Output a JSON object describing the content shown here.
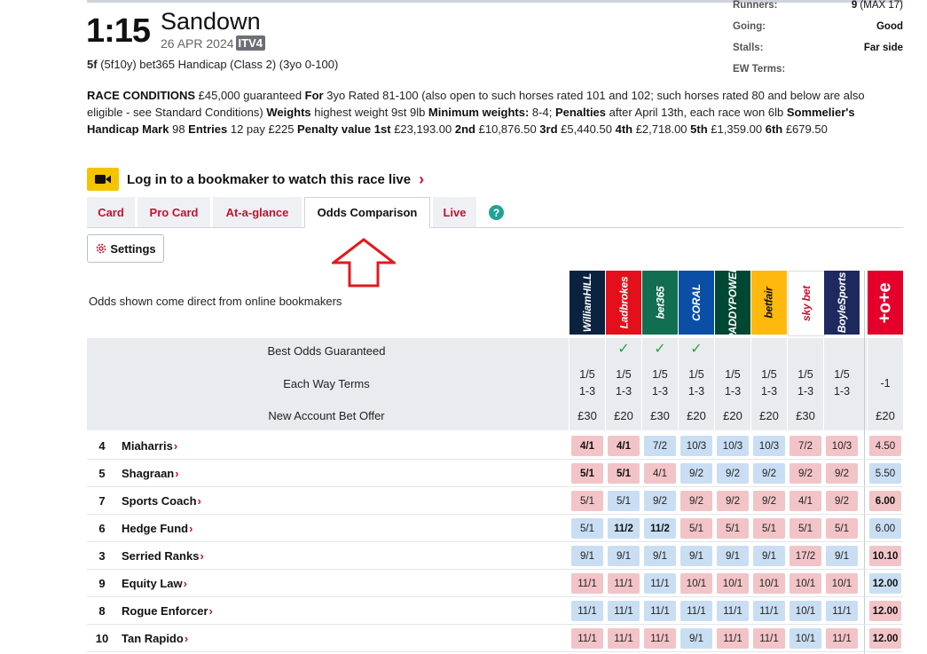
{
  "race": {
    "time": "1:15",
    "course": "Sandown",
    "date": "26 APR 2024",
    "channel": "ITV4",
    "distance": "5f",
    "description": "(5f10y) bet365 Handicap (Class 2) (3yo 0-100)"
  },
  "meta": [
    {
      "label": "Runners:",
      "value": "9",
      "extra": "(MAX 17)"
    },
    {
      "label": "Going:",
      "value": "Good",
      "extra": ""
    },
    {
      "label": "Stalls:",
      "value": "Far side",
      "extra": ""
    },
    {
      "label": "EW Terms:",
      "value": "",
      "extra": ""
    }
  ],
  "conditions": [
    {
      "b": "RACE CONDITIONS",
      "t": " £45,000 guaranteed "
    },
    {
      "b": "For",
      "t": " 3yo Rated 81-100 (also open to such horses rated 101 and 102; such horses rated 80 and below are also eligible - see Standard Conditions) "
    },
    {
      "b": "Weights",
      "t": " highest weight 9st 9lb "
    },
    {
      "b": "Minimum weights:",
      "t": " 8-4; "
    },
    {
      "b": "Penalties",
      "t": " after April 13th, each race won 6lb "
    },
    {
      "b": "Sommelier's Handicap Mark",
      "t": " 98 "
    },
    {
      "b": "Entries",
      "t": " 12 pay £225 "
    },
    {
      "b": "Penalty value",
      "t": " "
    },
    {
      "b": "1st",
      "t": " £23,193.00 "
    },
    {
      "b": "2nd",
      "t": " £10,876.50 "
    },
    {
      "b": "3rd",
      "t": " £5,440.50 "
    },
    {
      "b": "4th",
      "t": " £2,718.00 "
    },
    {
      "b": "5th",
      "t": " £1,359.00 "
    },
    {
      "b": "6th",
      "t": " £679.50"
    }
  ],
  "live_banner": {
    "text": "Log in to a bookmaker to watch this race live",
    "icon": "video-camera-icon"
  },
  "tabs": [
    "Card",
    "Pro Card",
    "At-a-glance",
    "Odds Comparison",
    "Live"
  ],
  "active_tab": "Odds Comparison",
  "settings_label": "Settings",
  "odds_note": "Odds shown come direct from online bookmakers",
  "bookmakers": [
    {
      "name": "William Hill",
      "logo": "WilliamHILL",
      "color": "#0a2240"
    },
    {
      "name": "Ladbrokes",
      "logo": "Ladbrokes",
      "color": "#e3101b"
    },
    {
      "name": "bet365",
      "logo": "bet365",
      "color": "#126e51"
    },
    {
      "name": "Coral",
      "logo": "CORAL",
      "color": "#0a4ea6"
    },
    {
      "name": "Paddy Power",
      "logo": "PADDYPOWER",
      "color": "#004833"
    },
    {
      "name": "Betfair",
      "logo": "betfair",
      "color": "#ffb80c"
    },
    {
      "name": "Sky Bet",
      "logo": "sky bet",
      "color": "#ffffff"
    },
    {
      "name": "BoyleSports",
      "logo": "BoyleSports",
      "color": "#1e2a5e"
    },
    {
      "name": "Tote",
      "logo": "+o+e",
      "color": "#e4002b"
    }
  ],
  "features": {
    "best_odds_label": "Best Odds Guaranteed",
    "best_odds": [
      false,
      true,
      true,
      true,
      false,
      false,
      false,
      false,
      false
    ],
    "each_way_label": "Each Way Terms",
    "each_way": [
      [
        "1/5",
        "1-3"
      ],
      [
        "1/5",
        "1-3"
      ],
      [
        "1/5",
        "1-3"
      ],
      [
        "1/5",
        "1-3"
      ],
      [
        "1/5",
        "1-3"
      ],
      [
        "1/5",
        "1-3"
      ],
      [
        "1/5",
        "1-3"
      ],
      [
        "1/5",
        "1-3"
      ],
      [
        "-1",
        ""
      ]
    ],
    "new_account_label": "New Account Bet Offer",
    "new_account": [
      "£30",
      "£20",
      "£30",
      "£20",
      "£20",
      "£20",
      "£30",
      "",
      "£20"
    ]
  },
  "runners": [
    {
      "number": "4",
      "name": "Miaharris",
      "odds": [
        "4/1",
        "4/1",
        "7/2",
        "10/3",
        "10/3",
        "10/3",
        "7/2",
        "10/3",
        "4.50"
      ],
      "colors": [
        "p",
        "p",
        "b",
        "b",
        "b",
        "b",
        "p",
        "p",
        "p"
      ],
      "bold": [
        true,
        true,
        false,
        false,
        false,
        false,
        false,
        false,
        false
      ]
    },
    {
      "number": "5",
      "name": "Shagraan",
      "odds": [
        "5/1",
        "5/1",
        "4/1",
        "9/2",
        "9/2",
        "9/2",
        "9/2",
        "9/2",
        "5.50"
      ],
      "colors": [
        "p",
        "p",
        "p",
        "b",
        "b",
        "b",
        "p",
        "p",
        "b"
      ],
      "bold": [
        true,
        true,
        false,
        false,
        false,
        false,
        false,
        false,
        false
      ]
    },
    {
      "number": "7",
      "name": "Sports Coach",
      "odds": [
        "5/1",
        "5/1",
        "9/2",
        "9/2",
        "9/2",
        "9/2",
        "4/1",
        "9/2",
        "6.00"
      ],
      "colors": [
        "p",
        "b",
        "b",
        "p",
        "p",
        "p",
        "p",
        "p",
        "p"
      ],
      "bold": [
        false,
        false,
        false,
        false,
        false,
        false,
        false,
        false,
        true
      ]
    },
    {
      "number": "6",
      "name": "Hedge Fund",
      "odds": [
        "5/1",
        "11/2",
        "11/2",
        "5/1",
        "5/1",
        "5/1",
        "5/1",
        "5/1",
        "6.00"
      ],
      "colors": [
        "b",
        "b",
        "b",
        "p",
        "p",
        "p",
        "p",
        "p",
        "b"
      ],
      "bold": [
        false,
        true,
        true,
        false,
        false,
        false,
        false,
        false,
        false
      ]
    },
    {
      "number": "3",
      "name": "Serried Ranks",
      "odds": [
        "9/1",
        "9/1",
        "9/1",
        "9/1",
        "9/1",
        "9/1",
        "17/2",
        "9/1",
        "10.10"
      ],
      "colors": [
        "b",
        "b",
        "b",
        "b",
        "b",
        "b",
        "p",
        "b",
        "p"
      ],
      "bold": [
        false,
        false,
        false,
        false,
        false,
        false,
        false,
        false,
        true
      ]
    },
    {
      "number": "9",
      "name": "Equity Law",
      "odds": [
        "11/1",
        "11/1",
        "11/1",
        "10/1",
        "10/1",
        "10/1",
        "10/1",
        "10/1",
        "12.00"
      ],
      "colors": [
        "p",
        "p",
        "b",
        "p",
        "p",
        "p",
        "p",
        "p",
        "b"
      ],
      "bold": [
        false,
        false,
        false,
        false,
        false,
        false,
        false,
        false,
        true
      ]
    },
    {
      "number": "8",
      "name": "Rogue Enforcer",
      "odds": [
        "11/1",
        "11/1",
        "11/1",
        "11/1",
        "11/1",
        "11/1",
        "10/1",
        "11/1",
        "12.00"
      ],
      "colors": [
        "b",
        "b",
        "b",
        "b",
        "b",
        "b",
        "b",
        "b",
        "p"
      ],
      "bold": [
        false,
        false,
        false,
        false,
        false,
        false,
        false,
        false,
        true
      ]
    },
    {
      "number": "10",
      "name": "Tan Rapido",
      "odds": [
        "11/1",
        "11/1",
        "11/1",
        "9/1",
        "11/1",
        "11/1",
        "10/1",
        "11/1",
        "12.00"
      ],
      "colors": [
        "p",
        "p",
        "p",
        "b",
        "p",
        "p",
        "b",
        "p",
        "p"
      ],
      "bold": [
        false,
        false,
        false,
        false,
        false,
        false,
        false,
        false,
        true
      ]
    }
  ]
}
